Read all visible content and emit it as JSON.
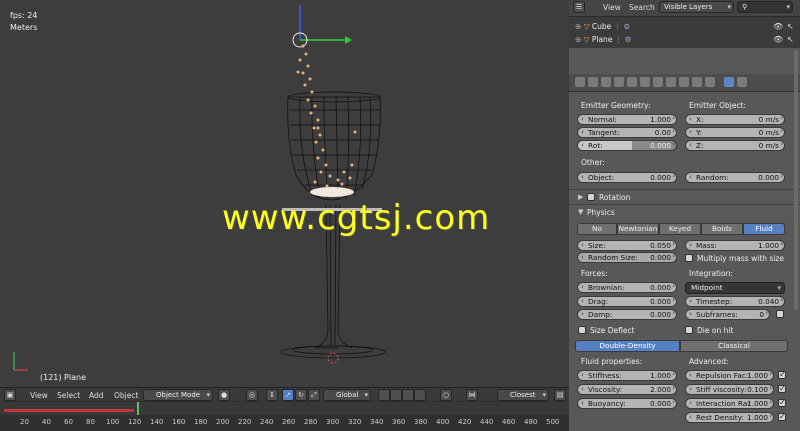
{
  "viewport": {
    "fps": "fps: 24",
    "units": "Meters",
    "object_info": "(121) Plane"
  },
  "watermark": "www.cgtsj.com",
  "timeline": {
    "menu": [
      "View",
      "Select",
      "Add",
      "Object"
    ],
    "mode": "Object Mode",
    "orientation": "Global",
    "snap": "Closest",
    "ticks": [
      "20",
      "40",
      "60",
      "80",
      "100",
      "120",
      "140",
      "160",
      "180",
      "200",
      "220",
      "240",
      "260",
      "280",
      "300",
      "320",
      "340",
      "360",
      "380",
      "400",
      "420",
      "440",
      "460",
      "480",
      "500"
    ],
    "current_frame": 121
  },
  "outliner": {
    "view": "View",
    "search": "Search",
    "display_mode": "Visible Layers",
    "items": [
      "Cube",
      "Plane"
    ]
  },
  "emitter": {
    "geometry_heading": "Emitter Geometry:",
    "object_heading": "Emitter Object:",
    "normal_label": "Normal:",
    "normal_value": "1.000",
    "tangent_label": "Tangent:",
    "tangent_value": "0.00",
    "rot_label": "Rot:",
    "rot_value": "0.000",
    "x_label": "X:",
    "x_value": "0 m/s",
    "y_label": "Y:",
    "y_value": "0 m/s",
    "z_label": "Z:",
    "z_value": "0 m/s",
    "other_heading": "Other:",
    "object_label": "Object:",
    "object_value": "0.000",
    "random_label": "Random:",
    "random_value": "0.000"
  },
  "rotation": {
    "label": "Rotation"
  },
  "physics": {
    "label": "Physics",
    "types": [
      "No",
      "Newtonian",
      "Keyed",
      "Boids",
      "Fluid"
    ],
    "selected_type": "Fluid",
    "size_label": "Size:",
    "size_value": "0.050",
    "random_size_label": "Random Size:",
    "random_size_value": "0.000",
    "mass_label": "Mass:",
    "mass_value": "1.000",
    "multiply_mass_label": "Multiply mass with size",
    "forces_heading": "Forces:",
    "integration_heading": "Integration:",
    "brownian_label": "Brownian:",
    "brownian_value": "0.000",
    "drag_label": "Drag:",
    "drag_value": "0.000",
    "damp_label": "Damp:",
    "damp_value": "0.000",
    "integration_method": "Midpoint",
    "timestep_label": "Timestep:",
    "timestep_value": "0.040",
    "subframes_label": "Subframes:",
    "subframes_value": "0",
    "size_deflect_label": "Size Deflect",
    "die_on_hit_label": "Die on hit",
    "density_modes": [
      "Double-Density",
      "Classical"
    ],
    "selected_density": "Double-Density",
    "fluid_props_heading": "Fluid properties:",
    "advanced_heading": "Advanced:",
    "stiffness_label": "Stiffness:",
    "stiffness_value": "1.000",
    "viscosity_label": "Viscosity:",
    "viscosity_value": "2.000",
    "buoyancy_label": "Buoyancy:",
    "buoyancy_value": "0.000",
    "repulsion_label": "Repulsion Fac:",
    "repulsion_value": "1.000",
    "stiff_visc_label": "Stiff viscosity:",
    "stiff_visc_value": "0.100",
    "interaction_label": "Interaction Ra:",
    "interaction_value": "1.000",
    "rest_density_label": "Rest Density:",
    "rest_density_value": "1.000"
  },
  "colors": {
    "accent_blue": "#5680c2",
    "watermark_yellow": "#ffff1e",
    "playhead_green": "#5cc15c"
  }
}
